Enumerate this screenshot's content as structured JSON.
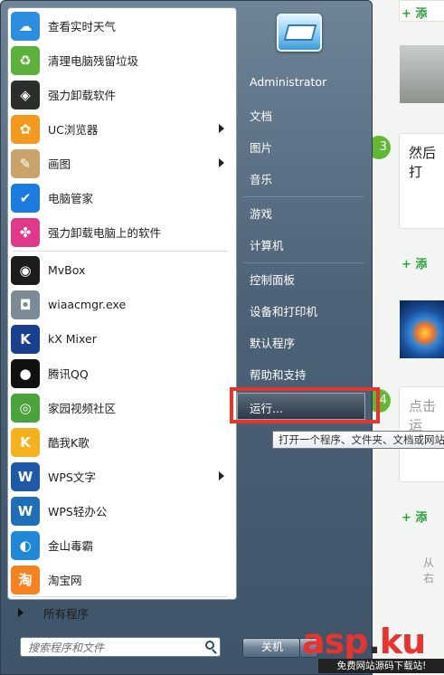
{
  "programs": [
    {
      "label": "查看实时天气",
      "icon": "weather-icon",
      "color": "#2b8ee0",
      "submenu": false
    },
    {
      "label": "清理电脑残留垃圾",
      "icon": "recycle-icon",
      "color": "#5cb13a",
      "submenu": false
    },
    {
      "label": "强力卸载软件",
      "icon": "uninstall-icon",
      "color": "#2a2f2a",
      "submenu": false
    },
    {
      "label": "UC浏览器",
      "icon": "uc-browser-icon",
      "color": "#f39a1e",
      "submenu": true
    },
    {
      "label": "画图",
      "icon": "paint-icon",
      "color": "#c9a36a",
      "submenu": true
    },
    {
      "label": "电脑管家",
      "icon": "shield-icon",
      "color": "#1a7ce0",
      "submenu": false
    },
    {
      "label": "强力卸载电脑上的软件",
      "icon": "clover-icon",
      "color": "#e0398c",
      "submenu": false
    },
    {
      "label": "MvBox",
      "icon": "mvbox-icon",
      "color": "#1c1c1c",
      "submenu": false
    },
    {
      "label": "wiaacmgr.exe",
      "icon": "camera-icon",
      "color": "#7c8a96",
      "submenu": false
    },
    {
      "label": "kX Mixer",
      "icon": "kx-mixer-icon",
      "color": "#1b3f8f",
      "submenu": false
    },
    {
      "label": "腾讯QQ",
      "icon": "qq-penguin-icon",
      "color": "#111111",
      "submenu": false
    },
    {
      "label": "家园视频社区",
      "icon": "video-community-icon",
      "color": "#4aa33b",
      "submenu": false
    },
    {
      "label": "酷我K歌",
      "icon": "kuwo-k-icon",
      "color": "#f5b21c",
      "submenu": false
    },
    {
      "label": "WPS文字",
      "icon": "wps-writer-icon",
      "color": "#1f5aa8",
      "submenu": true
    },
    {
      "label": "WPS轻办公",
      "icon": "wps-office-icon",
      "color": "#1d6fb8",
      "submenu": false
    },
    {
      "label": "金山毒霸",
      "icon": "kingsoft-antivirus-icon",
      "color": "#1f88d8",
      "submenu": false
    },
    {
      "label": "淘宝网",
      "icon": "taobao-icon",
      "color": "#f5811f",
      "submenu": false
    }
  ],
  "all_programs": "所有程序",
  "search": {
    "placeholder": "搜索程序和文件"
  },
  "right": {
    "user": "Administrator",
    "links": [
      "文档",
      "图片",
      "音乐",
      "游戏",
      "计算机",
      "控制面板",
      "设备和打印机",
      "默认程序",
      "帮助和支持"
    ],
    "run": "运行...",
    "tooltip": "打开一个程序、文件夹、文档或网站",
    "shutdown": "关机"
  },
  "background": {
    "add_label": "+ 添",
    "step": "3",
    "step_text": "然后打",
    "step2": "4",
    "step2_text": "点击运",
    "footer": "从右"
  },
  "watermark": {
    "main_a": "asp",
    "main_b": "ku",
    "dot": ".",
    "sub": "免费网站源码下载站!"
  }
}
